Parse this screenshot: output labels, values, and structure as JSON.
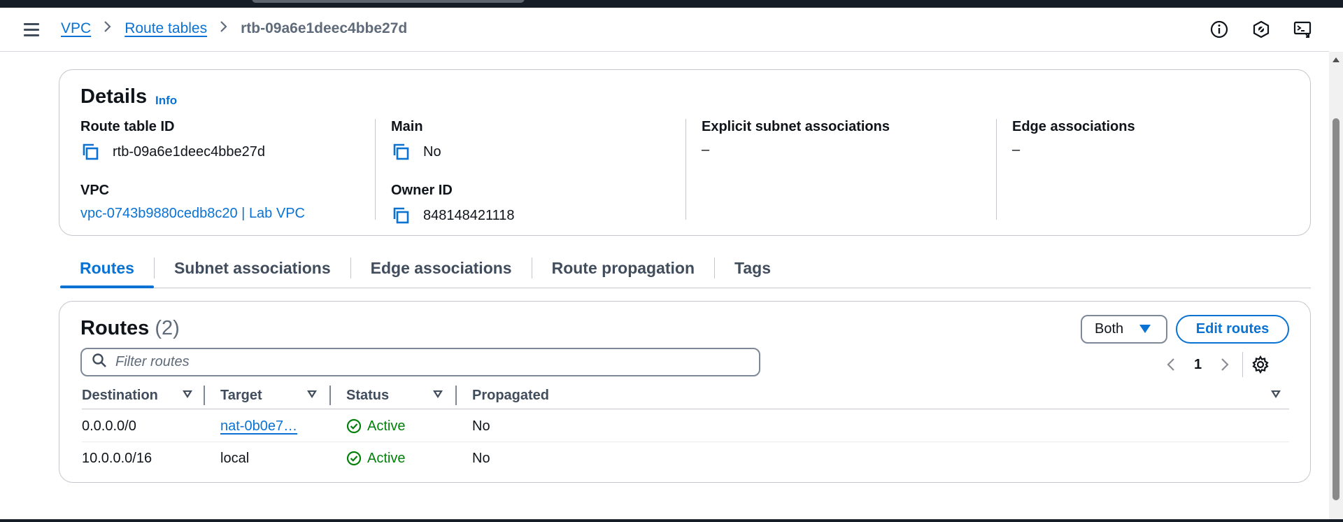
{
  "header": {
    "breadcrumbs": [
      "VPC",
      "Route tables"
    ],
    "current": "rtb-09a6e1deec4bbe27d",
    "icons": [
      "info-icon",
      "notifications-icon",
      "cloudshell-icon"
    ]
  },
  "details": {
    "title": "Details",
    "info_label": "Info",
    "route_table_id_label": "Route table ID",
    "route_table_id": "rtb-09a6e1deec4bbe27d",
    "vpc_label": "VPC",
    "vpc_value": "vpc-0743b9880cedb8c20 | Lab VPC",
    "main_label": "Main",
    "main_value": "No",
    "owner_id_label": "Owner ID",
    "owner_id": "848148421118",
    "explicit_label": "Explicit subnet associations",
    "explicit_value": "–",
    "edge_label": "Edge associations",
    "edge_value": "–"
  },
  "tabs": [
    "Routes",
    "Subnet associations",
    "Edge associations",
    "Route propagation",
    "Tags"
  ],
  "routes": {
    "title": "Routes",
    "count": "(2)",
    "filter_select": "Both",
    "edit_button": "Edit routes",
    "filter_placeholder": "Filter routes",
    "page": "1",
    "columns": [
      "Destination",
      "Target",
      "Status",
      "Propagated"
    ],
    "rows": [
      {
        "destination": "0.0.0.0/0",
        "target": "nat-0b0e7…",
        "status": "Active",
        "propagated": "No"
      },
      {
        "destination": "10.0.0.0/16",
        "target": "local",
        "status": "Active",
        "propagated": "No"
      }
    ]
  },
  "colors": {
    "link": "#0972d3",
    "success": "#037f0c",
    "text": "#0f141a",
    "border": "#c6c6cd"
  }
}
